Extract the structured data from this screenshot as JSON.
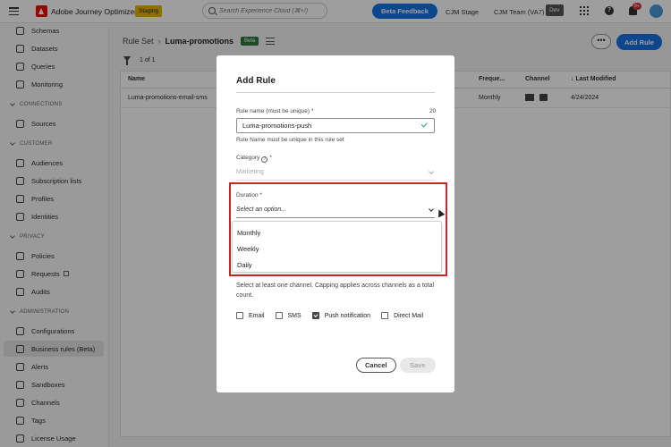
{
  "topbar": {
    "app_title": "Adobe Journey Optimizer",
    "env_badge": "Staging",
    "search_placeholder": "Search Experience Cloud (⌘+/)",
    "beta_feedback": "Beta Feedback",
    "org_stage": "CJM Stage",
    "org_team": "CJM Team (VA7)",
    "dev_badge": "Dev",
    "notification_count": "9+"
  },
  "sidebar": {
    "items_top": [
      "Schemas",
      "Datasets",
      "Queries",
      "Monitoring"
    ],
    "section_connections": "CONNECTIONS",
    "connections": [
      "Sources"
    ],
    "section_customer": "CUSTOMER",
    "customer": [
      "Audiences",
      "Subscription lists",
      "Profiles",
      "Identities"
    ],
    "section_privacy": "PRIVACY",
    "privacy": [
      "Policies",
      "Requests",
      "Audits"
    ],
    "section_administration": "ADMINISTRATION",
    "administration": [
      "Configurations",
      "Business rules (Beta)",
      "Alerts",
      "Sandboxes",
      "Channels",
      "Tags",
      "License Usage"
    ]
  },
  "main": {
    "breadcrumb_root": "Rule Set",
    "breadcrumb_current": "Luma-promotions",
    "beta": "Beta",
    "more": "•••",
    "add_rule": "Add Rule",
    "count": "1 of 1",
    "columns": [
      "Name",
      "Freque...",
      "Channel",
      "Last Modified"
    ],
    "row": {
      "name": "Luma-promotions-email-sms",
      "frequency": "Monthly",
      "last_modified": "4/24/2024"
    }
  },
  "modal": {
    "title": "Add Rule",
    "name_label": "Rule name (must be unique) *",
    "char_count": "20",
    "name_value": "Luma-promotions-push",
    "name_helper": "Rule Name must be unique in this rule set",
    "category_label": "Category",
    "category_value": "Marketing",
    "duration_label": "Duration *",
    "duration_placeholder": "Select an option...",
    "duration_options": [
      "Monthly",
      "Weekly",
      "Daily"
    ],
    "channel_note": "Select at least one channel. Capping applies across channels as a total count.",
    "channels": [
      {
        "label": "Email",
        "checked": false
      },
      {
        "label": "SMS",
        "checked": false
      },
      {
        "label": "Push notification",
        "checked": true
      },
      {
        "label": "Direct Mail",
        "checked": false
      }
    ],
    "cancel": "Cancel",
    "save": "Save"
  }
}
